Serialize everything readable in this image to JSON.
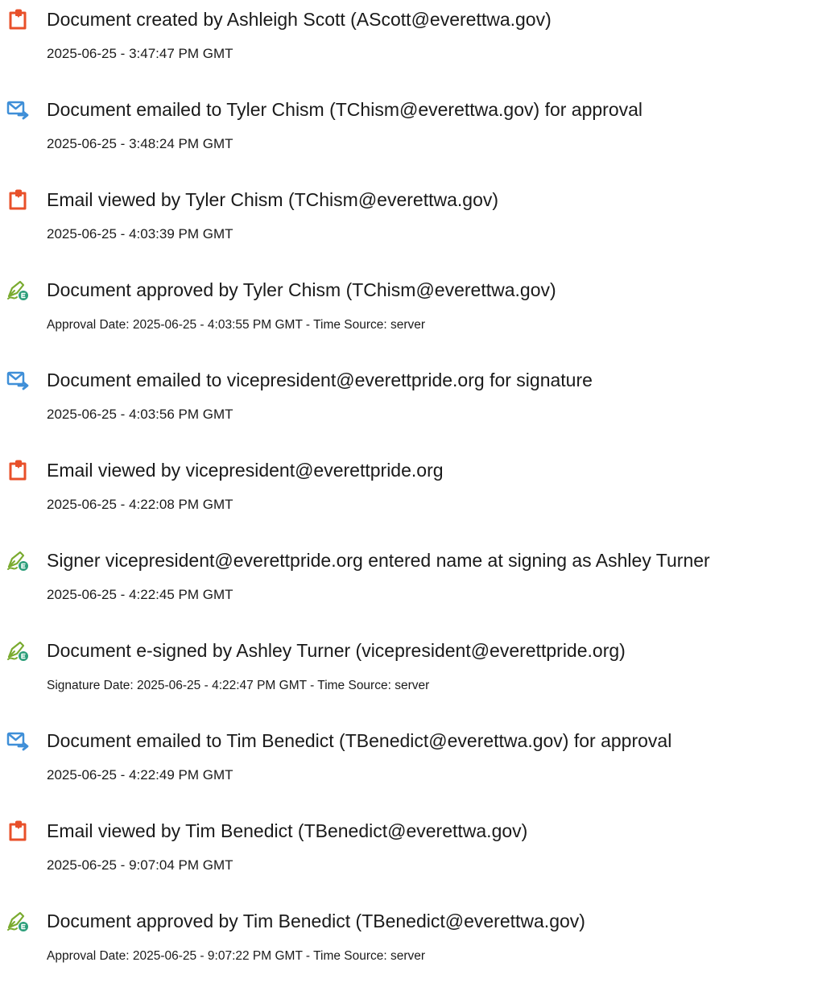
{
  "colors": {
    "document_icon": "#e8502a",
    "email_icon": "#3f8fd8",
    "sign_icon_pen": "#7aab2f",
    "sign_icon_badge": "#2c9e7a",
    "text": "#1a1a1a"
  },
  "events": [
    {
      "icon": "document-icon",
      "title": "Document created by Ashleigh Scott (AScott@everettwa.gov)",
      "detail": "2025-06-25 - 3:47:47 PM GMT"
    },
    {
      "icon": "email-send-icon",
      "title": "Document emailed to Tyler Chism (TChism@everettwa.gov) for approval",
      "detail": "2025-06-25 - 3:48:24 PM GMT"
    },
    {
      "icon": "document-icon",
      "title": "Email viewed by Tyler Chism (TChism@everettwa.gov)",
      "detail": "2025-06-25 - 4:03:39 PM GMT"
    },
    {
      "icon": "sign-pen-icon",
      "title": "Document approved by Tyler Chism (TChism@everettwa.gov)",
      "detail": "Approval Date: 2025-06-25 - 4:03:55 PM GMT - Time Source: server"
    },
    {
      "icon": "email-send-icon",
      "title": "Document emailed to vicepresident@everettpride.org for signature",
      "detail": "2025-06-25 - 4:03:56 PM GMT"
    },
    {
      "icon": "document-icon",
      "title": "Email viewed by vicepresident@everettpride.org",
      "detail": "2025-06-25 - 4:22:08 PM GMT"
    },
    {
      "icon": "sign-pen-icon",
      "title": "Signer vicepresident@everettpride.org entered name at signing as Ashley Turner",
      "detail": "2025-06-25 - 4:22:45 PM GMT"
    },
    {
      "icon": "sign-pen-icon",
      "title": "Document e-signed by Ashley Turner (vicepresident@everettpride.org)",
      "detail": "Signature Date: 2025-06-25 - 4:22:47 PM GMT - Time Source: server"
    },
    {
      "icon": "email-send-icon",
      "title": "Document emailed to Tim Benedict (TBenedict@everettwa.gov) for approval",
      "detail": "2025-06-25 - 4:22:49 PM GMT"
    },
    {
      "icon": "document-icon",
      "title": "Email viewed by Tim Benedict (TBenedict@everettwa.gov)",
      "detail": "2025-06-25 - 9:07:04 PM GMT"
    },
    {
      "icon": "sign-pen-icon",
      "title": "Document approved by Tim Benedict (TBenedict@everettwa.gov)",
      "detail": "Approval Date: 2025-06-25 - 9:07:22 PM GMT - Time Source: server"
    }
  ]
}
